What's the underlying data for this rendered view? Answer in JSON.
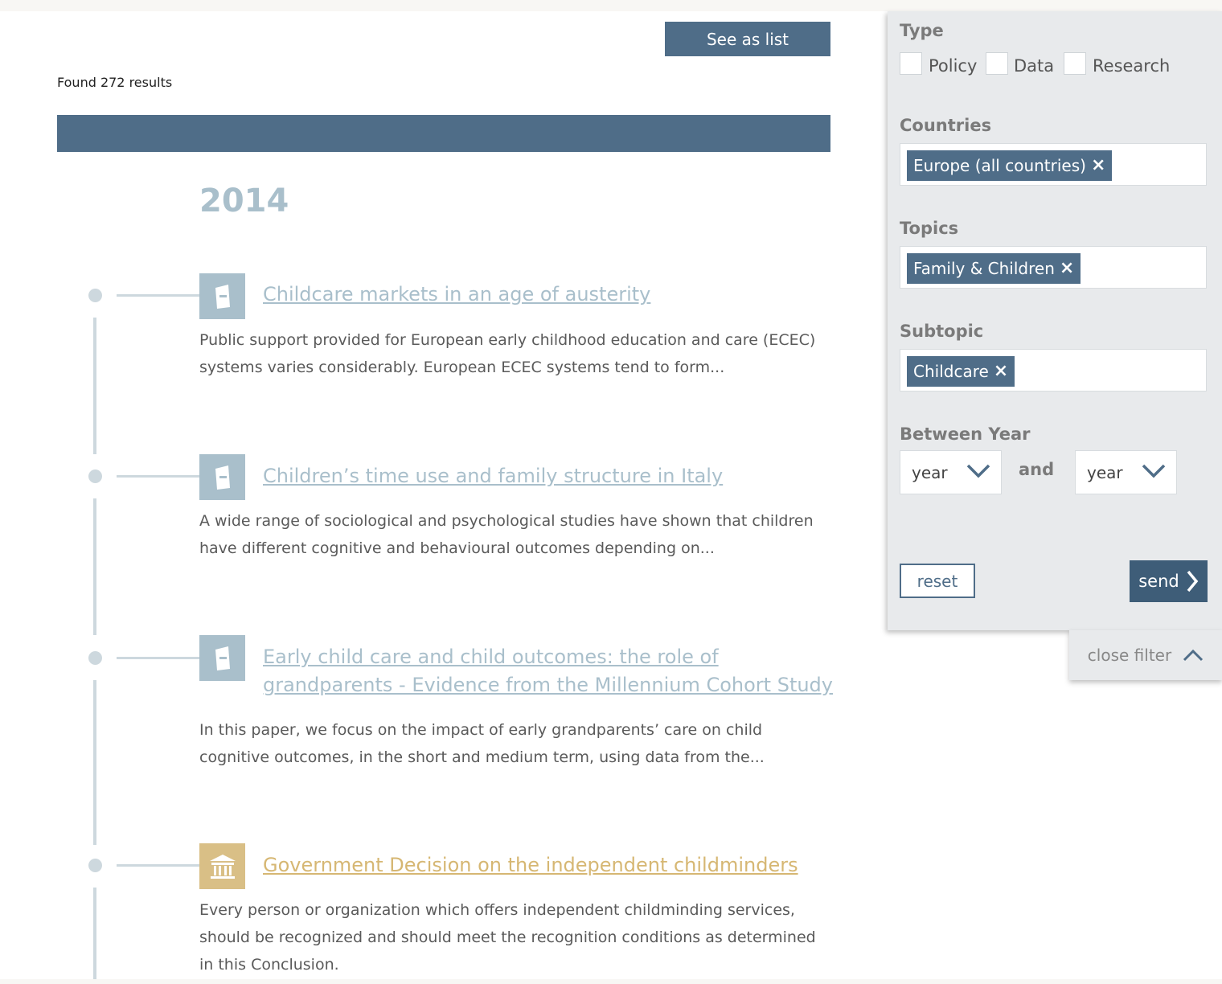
{
  "header": {
    "see_list_label": "See as list",
    "found_text": "Found 272 results"
  },
  "timeline": {
    "year": "2014",
    "items": [
      {
        "type": "document",
        "title": "Childcare markets in an age of austerity",
        "description": "Public support provided for European early childhood education and care (ECEC) systems varies considerably. European ECEC systems tend to form..."
      },
      {
        "type": "document",
        "title": "Children’s time use and family structure in Italy",
        "description": "A wide range of sociological and psychological studies have shown that children have different cognitive and behavioural outcomes depending on..."
      },
      {
        "type": "document",
        "title": "Early child care and child outcomes: the role of grandparents - Evidence from the Millennium Cohort Study",
        "description": "In this paper, we focus on the impact of early grandparents’ care on child cognitive outcomes, in the short and medium term, using data from the..."
      },
      {
        "type": "government",
        "title": "Government Decision on the independent childminders",
        "description": "Every person or organization which offers independent childminding services, should be recognized and should meet the recognition conditions as determined in this Conclusion."
      }
    ]
  },
  "filter": {
    "type_label": "Type",
    "type_options": [
      {
        "label": "Policy",
        "checked": false
      },
      {
        "label": "Data",
        "checked": false
      },
      {
        "label": "Research",
        "checked": false
      }
    ],
    "countries_label": "Countries",
    "countries_tag": "Europe (all countries)",
    "topics_label": "Topics",
    "topics_tag": "Family & Children",
    "subtopic_label": "Subtopic",
    "subtopic_tag": "Childcare",
    "between_label": "Between Year",
    "year_from": "year",
    "and_label": "and",
    "year_to": "year",
    "reset_label": "reset",
    "send_label": "send",
    "close_label": "close filter",
    "remove_glyph": "×"
  },
  "colors": {
    "accent": "#4f6d88",
    "doc_icon": "#a9bfcb",
    "gov_icon": "#d9bf86"
  }
}
